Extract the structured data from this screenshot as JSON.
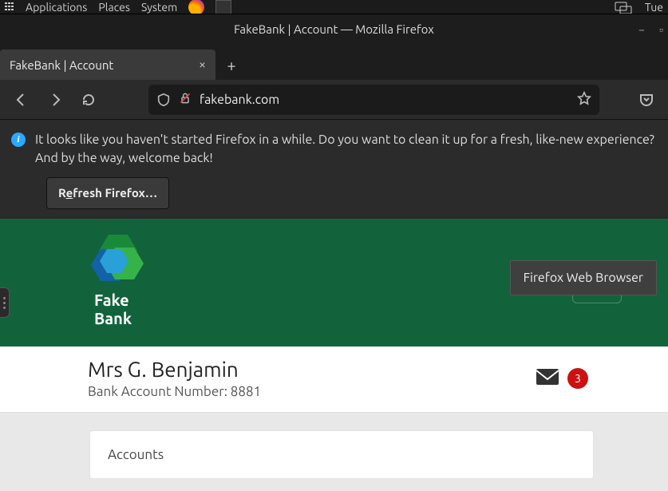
{
  "desktop": {
    "menus": [
      "Applications",
      "Places",
      "System"
    ],
    "clock": "Tue"
  },
  "firefox": {
    "window_title": "FakeBank | Account — Mozilla Firefox",
    "tab_title": "FakeBank | Account",
    "url": "fakebank.com",
    "info_message": "It looks like you haven't started Firefox in a while. Do you want to clean it up for a fresh, like-new experience? And by the way, welcome back!",
    "refresh_prefix": "R",
    "refresh_ul": "e",
    "refresh_suffix": "fresh Firefox…",
    "tooltip": "Firefox Web Browser"
  },
  "bank": {
    "brand_line1": "Fake",
    "brand_line2": "Bank",
    "account_name": "Mrs G. Benjamin",
    "account_sub": "Bank Account Number: 8881",
    "mail_count": "3",
    "card_title": "Accounts"
  }
}
